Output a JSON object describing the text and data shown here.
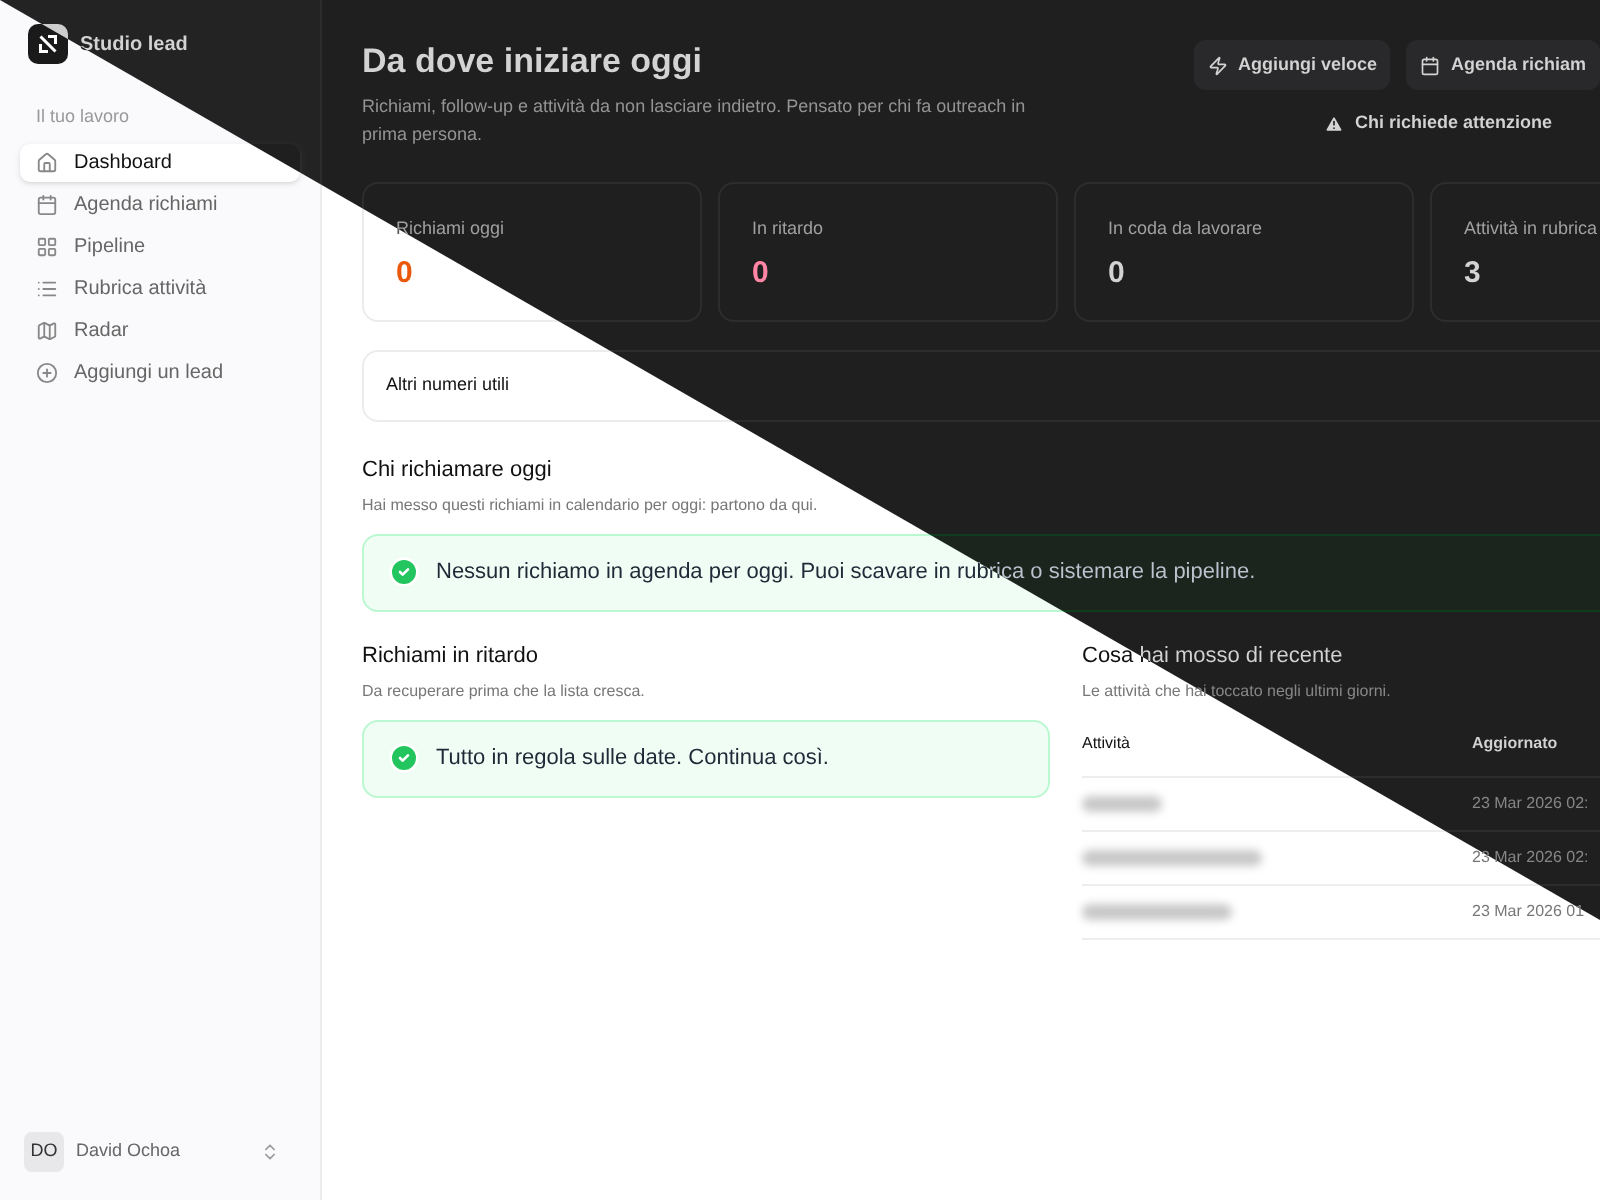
{
  "sidebar": {
    "brand": "Studio lead",
    "section_label": "Il tuo lavoro",
    "items": [
      {
        "label": "Dashboard",
        "selected": true
      },
      {
        "label": "Agenda richiami",
        "selected": false
      },
      {
        "label": "Pipeline",
        "selected": false
      },
      {
        "label": "Rubrica attività",
        "selected": false
      },
      {
        "label": "Radar",
        "selected": false
      },
      {
        "label": "Aggiungi un lead",
        "selected": false
      }
    ],
    "user": {
      "initials": "DO",
      "name": "David Ochoa"
    }
  },
  "header": {
    "title": "Da dove iniziare oggi",
    "subtitle": "Richiami, follow-up e attività da non lasciare indietro. Pensato per chi fa outreach in prima persona.",
    "buttons": [
      {
        "label": "Aggiungi veloce"
      },
      {
        "label": "Agenda richiam"
      }
    ],
    "attention_link": "Chi richiede attenzione"
  },
  "stats": [
    {
      "label": "Richiami oggi",
      "value": "0",
      "kind": "warning"
    },
    {
      "label": "In ritardo",
      "value": "0",
      "kind": "danger"
    },
    {
      "label": "In coda da lavorare",
      "value": "0",
      "kind": "plain"
    },
    {
      "label": "Attività in rubrica",
      "value": "3",
      "kind": "plain"
    }
  ],
  "other_numbers": "Altri numeri utili",
  "today": {
    "title": "Chi richiamare oggi",
    "subtitle": "Hai messo questi richiami in calendario per oggi: partono da qui.",
    "notice": "Nessun richiamo in agenda per oggi. Puoi scavare in rubrica o sistemare la pipeline."
  },
  "overdue": {
    "title": "Richiami in ritardo",
    "subtitle": "Da recuperare prima che la lista cresca.",
    "notice": "Tutto in regola sulle date. Continua così."
  },
  "recent": {
    "title": "Cosa hai mosso di recente",
    "subtitle": "Le attività che hai toccato negli ultimi giorni.",
    "columns": [
      "Attività",
      "Aggiornato"
    ],
    "rows": [
      {
        "updated": "23 Mar 2026 02:"
      },
      {
        "updated": "23 Mar 2026 02:"
      },
      {
        "updated": "23 Mar 2026 01"
      }
    ]
  }
}
